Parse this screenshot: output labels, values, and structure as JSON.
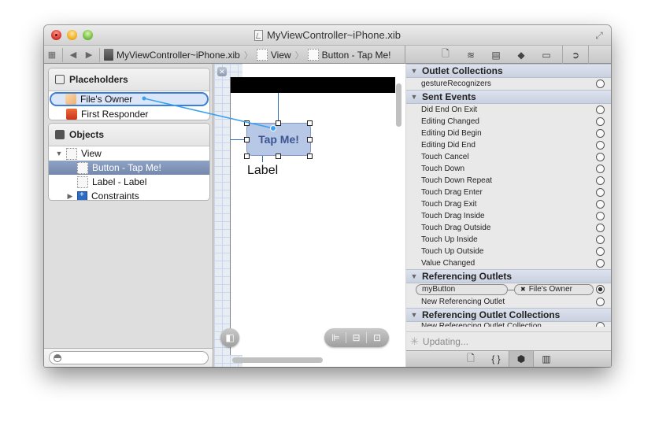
{
  "window": {
    "title": "MyViewController~iPhone.xib"
  },
  "jumpbar": {
    "items": [
      "MyViewController~iPhone.xib",
      "View",
      "Button - Tap Me!"
    ]
  },
  "inspector_tabs": [
    "file-inspector",
    "quick-help",
    "identity-inspector",
    "attributes-inspector",
    "size-inspector",
    "connections-inspector"
  ],
  "navigator": {
    "placeholders": {
      "title": "Placeholders",
      "items": [
        {
          "label": "File's Owner",
          "state": "connection-target"
        },
        {
          "label": "First Responder"
        }
      ]
    },
    "objects": {
      "title": "Objects",
      "items": [
        {
          "label": "View",
          "level": 0,
          "expanded": true
        },
        {
          "label": "Button - Tap Me!",
          "level": 1,
          "selected": true
        },
        {
          "label": "Label - Label",
          "level": 1
        },
        {
          "label": "Constraints",
          "level": 1,
          "expanded": false
        }
      ]
    },
    "filter": {
      "placeholder": ""
    }
  },
  "canvas": {
    "button_title": "Tap Me!",
    "label_text": "Label"
  },
  "connections": {
    "outlet_collections": {
      "title": "Outlet Collections",
      "items": [
        "gestureRecognizers"
      ]
    },
    "sent_events": {
      "title": "Sent Events",
      "items": [
        "Did End On Exit",
        "Editing Changed",
        "Editing Did Begin",
        "Editing Did End",
        "Touch Cancel",
        "Touch Down",
        "Touch Down Repeat",
        "Touch Drag Enter",
        "Touch Drag Exit",
        "Touch Drag Inside",
        "Touch Drag Outside",
        "Touch Up Inside",
        "Touch Up Outside",
        "Value Changed"
      ]
    },
    "referencing_outlets": {
      "title": "Referencing Outlets",
      "connection": {
        "outlet": "myButton",
        "target": "File's Owner"
      },
      "new_label": "New Referencing Outlet"
    },
    "referencing_outlet_collections": {
      "title": "Referencing Outlet Collections",
      "partial_label": "New Referencing Outlet Collection"
    },
    "status": "Updating..."
  },
  "library_tabs": [
    "file-templates",
    "code-snippets",
    "objects",
    "media"
  ]
}
